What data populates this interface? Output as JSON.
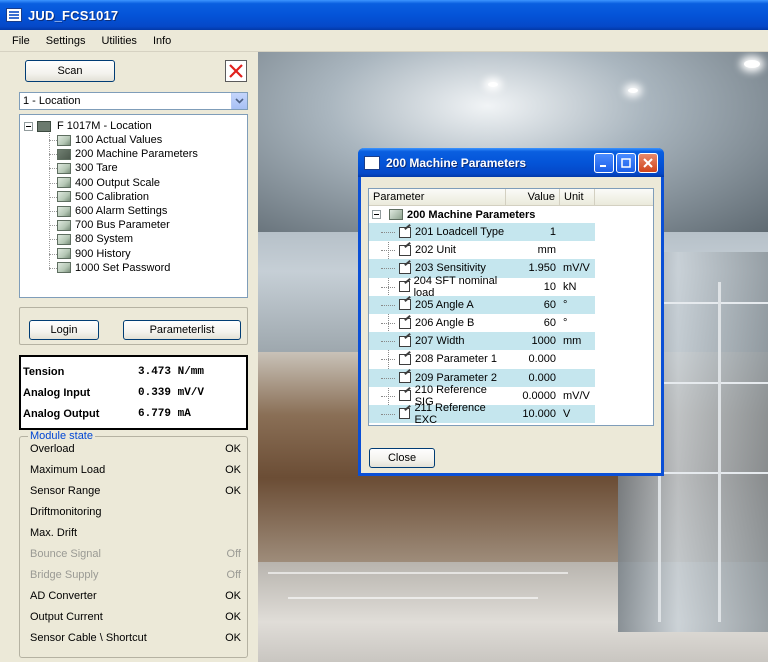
{
  "window": {
    "title": "JUD_FCS1017"
  },
  "menu": [
    "File",
    "Settings",
    "Utilities",
    "Info"
  ],
  "left": {
    "scan_label": "Scan",
    "location_select": "1 - Location",
    "tree": {
      "root": "F 1017M - Location",
      "items": [
        "100 Actual Values",
        "200 Machine Parameters",
        "300 Tare",
        "400 Output Scale",
        "500 Calibration",
        "600 Alarm Settings",
        "700 Bus Parameter",
        "800 System",
        "900 History",
        "1000 Set Password"
      ]
    },
    "login_label": "Login",
    "parameterlist_label": "Parameterlist",
    "values": [
      {
        "label": "Tension",
        "value": "3.473 N/mm"
      },
      {
        "label": "Analog Input",
        "value": "0.339 mV/V"
      },
      {
        "label": "Analog Output",
        "value": "6.779 mA"
      }
    ],
    "module_state": {
      "legend": "Module state",
      "rows": [
        {
          "label": "Overload",
          "value": "OK",
          "dim": false
        },
        {
          "label": "Maximum Load",
          "value": "OK",
          "dim": false
        },
        {
          "label": "Sensor Range",
          "value": "OK",
          "dim": false
        },
        {
          "label": "Driftmonitoring",
          "value": "",
          "dim": false
        },
        {
          "label": "Max. Drift",
          "value": "",
          "dim": false
        },
        {
          "label": "Bounce Signal",
          "value": "Off",
          "dim": true
        },
        {
          "label": "Bridge Supply",
          "value": "Off",
          "dim": true
        },
        {
          "label": "AD Converter",
          "value": "OK",
          "dim": false
        },
        {
          "label": "Output Current",
          "value": "OK",
          "dim": false
        },
        {
          "label": "Sensor Cable \\ Shortcut",
          "value": "OK",
          "dim": false
        }
      ]
    }
  },
  "dialog": {
    "title": "200 Machine Parameters",
    "columns": {
      "parameter": "Parameter",
      "value": "Value",
      "unit": "Unit"
    },
    "root": "200 Machine Parameters",
    "rows": [
      {
        "name": "201 Loadcell Type",
        "value": "1",
        "unit": ""
      },
      {
        "name": "202 Unit",
        "value": "mm",
        "unit": ""
      },
      {
        "name": "203 Sensitivity",
        "value": "1.950",
        "unit": "mV/V"
      },
      {
        "name": "204 SFT nominal load",
        "value": "10",
        "unit": "kN"
      },
      {
        "name": "205 Angle A",
        "value": "60",
        "unit": "°"
      },
      {
        "name": "206 Angle B",
        "value": "60",
        "unit": "°"
      },
      {
        "name": "207 Width",
        "value": "1000",
        "unit": "mm"
      },
      {
        "name": "208 Parameter 1",
        "value": "0.000",
        "unit": ""
      },
      {
        "name": "209 Parameter 2",
        "value": "0.000",
        "unit": ""
      },
      {
        "name": "210 Reference SIG",
        "value": "0.0000",
        "unit": "mV/V"
      },
      {
        "name": "211 Reference EXC",
        "value": "10.000",
        "unit": "V"
      }
    ],
    "close_label": "Close"
  }
}
